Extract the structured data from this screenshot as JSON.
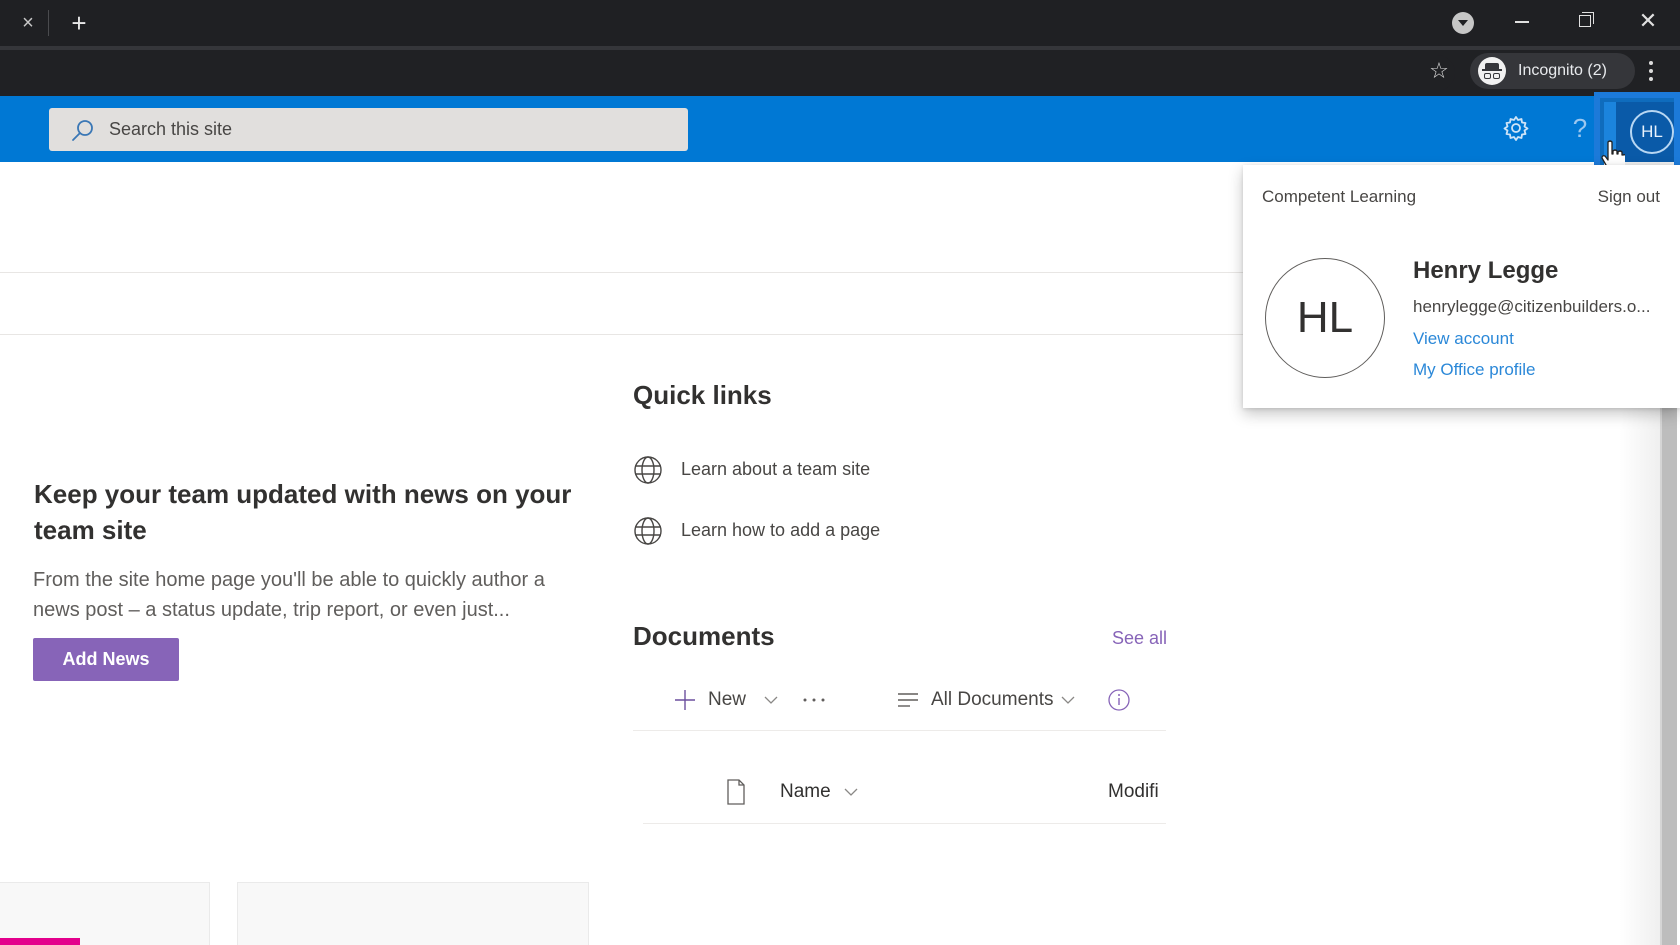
{
  "browser": {
    "tab_close_glyph": "×",
    "new_tab_glyph": "+",
    "window_close_glyph": "✕",
    "bookmark_star_glyph": "☆",
    "profile_label": "Incognito (2)"
  },
  "suitebar": {
    "search_placeholder": "Search this site",
    "search_value": "",
    "help_glyph": "?",
    "avatar_initials": "HL",
    "brand_color": "#0078d4"
  },
  "news": {
    "heading": "Keep your team updated with news on your team site",
    "body": "From the site home page you'll be able to quickly author a news post – a status update, trip report, or even just...",
    "add_button_label": "Add News",
    "button_color": "#8764b8"
  },
  "quick_links": {
    "heading": "Quick links",
    "items": [
      {
        "label": "Learn about a team site",
        "icon": "globe-icon"
      },
      {
        "label": "Learn how to add a page",
        "icon": "globe-icon"
      }
    ]
  },
  "documents": {
    "heading": "Documents",
    "see_all_label": "See all",
    "toolbar": {
      "new_label": "New",
      "more_label": "···",
      "view_label": "All Documents"
    },
    "columns": [
      {
        "label": "Name",
        "sortable": true
      },
      {
        "label": "Modifi"
      }
    ],
    "rows": []
  },
  "account_flyout": {
    "organization": "Competent Learning",
    "sign_out_label": "Sign out",
    "initials": "HL",
    "name": "Henry Legge",
    "email": "henrylegge@citizenbuilders.o...",
    "view_account_label": "View account",
    "office_profile_label": "My Office profile"
  }
}
